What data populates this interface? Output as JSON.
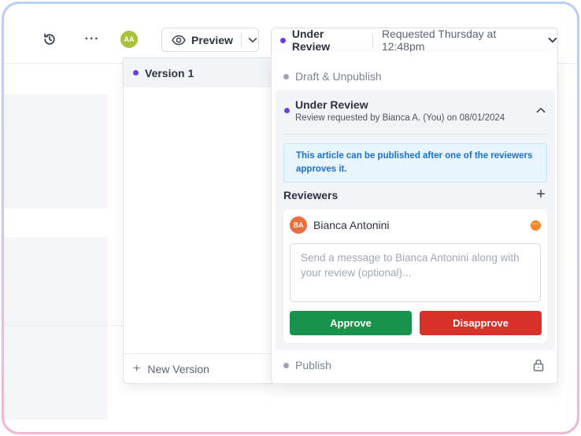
{
  "toolbar": {
    "history_icon": "history-icon",
    "more_icon": "more-horizontal-icon",
    "more_label": "···",
    "user_initials": "AA",
    "preview_label": "Preview",
    "status_label": "Under Review",
    "status_requested": "Requested Thursday at 12:48pm"
  },
  "versions": {
    "items": [
      {
        "label": "Version 1",
        "active": true
      }
    ],
    "new_version_label": "New Version"
  },
  "status_menu": {
    "draft_label": "Draft & Unpublish",
    "under_review": {
      "title": "Under Review",
      "subtitle": "Review requested by Bianca A. (You) on 08/01/2024",
      "notice": "This article can be published after one of the reviewers approves it.",
      "reviewers_title": "Reviewers",
      "reviewer": {
        "initials": "BA",
        "name": "Bianca Antonini",
        "status_glyph": "···",
        "message_placeholder": "Send a message to Bianca Antonini along with your review (optional)...",
        "approve_label": "Approve",
        "disapprove_label": "Disapprove"
      }
    },
    "publish_label": "Publish"
  },
  "colors": {
    "accent_purple": "#6d3ee0",
    "approve_green": "#17934c",
    "disapprove_red": "#d9302a",
    "notice_blue": "#1a6fd1",
    "avatar_aa": "#a8c23c",
    "avatar_ba": "#ea6e3e"
  }
}
